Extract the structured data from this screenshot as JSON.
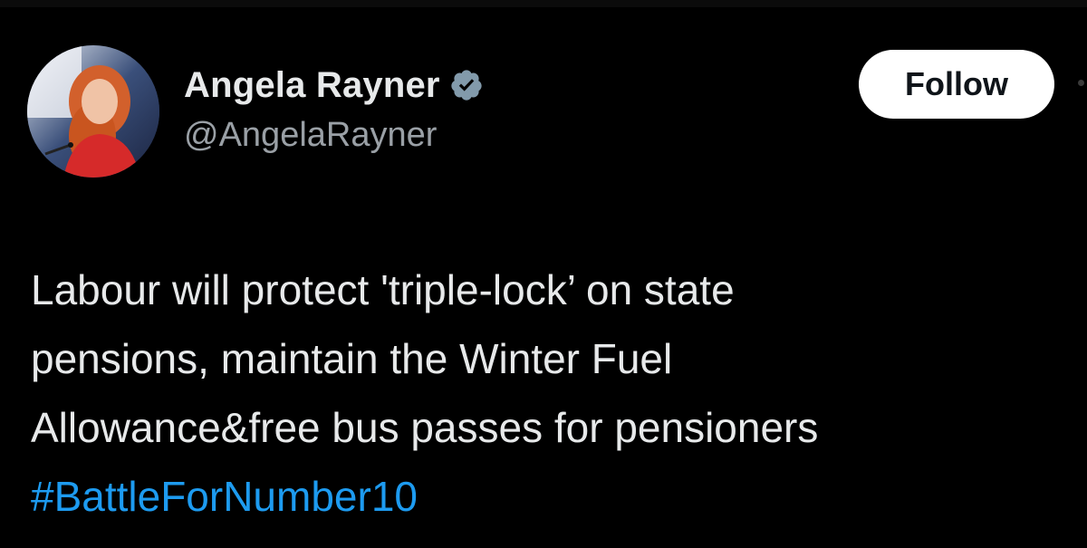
{
  "author": {
    "display_name": "Angela Rayner",
    "handle": "@AngelaRayner",
    "verified_icon": "verified-badge-icon",
    "avatar_description_icon": "profile-photo"
  },
  "actions": {
    "follow_label": "Follow"
  },
  "tweet": {
    "lines": [
      "Labour will protect 'triple-lock’ on state",
      "pensions, maintain the Winter Fuel",
      "Allowance&free bus passes for pensioners"
    ],
    "hashtag": "#BattleForNumber10"
  },
  "colors": {
    "background": "#000000",
    "text": "#e7e9ea",
    "secondary_text": "#9aa0a6",
    "link": "#1d9bf0",
    "follow_bg": "#ffffff",
    "follow_text": "#0f1419"
  }
}
